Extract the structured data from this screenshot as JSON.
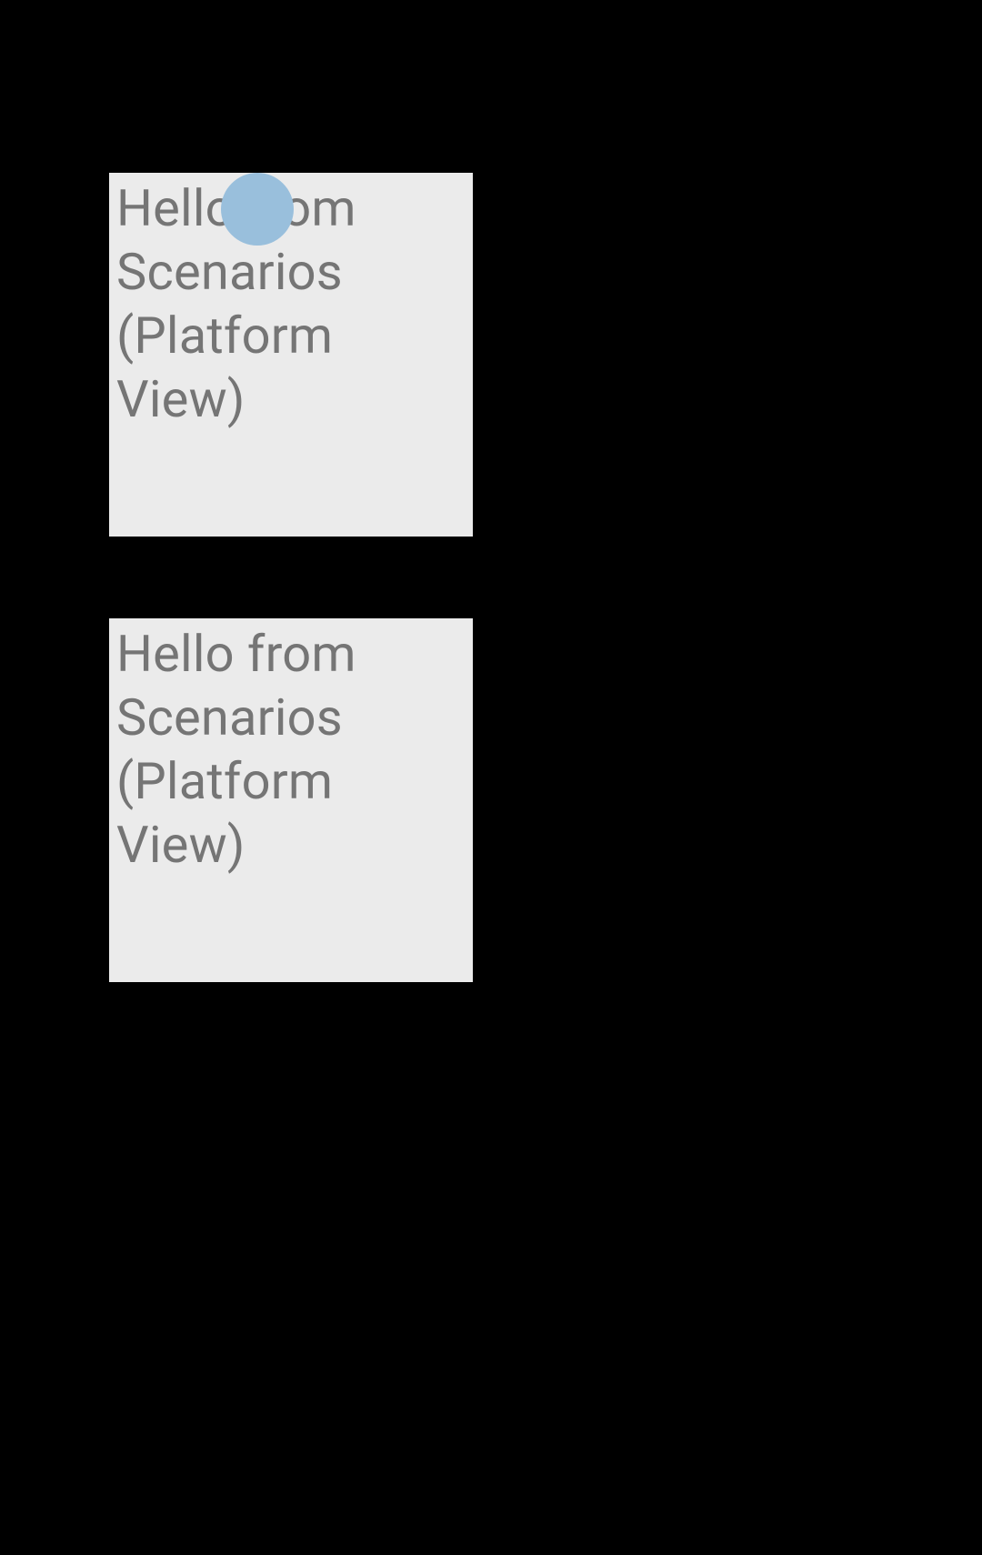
{
  "panels": [
    {
      "text": "Hello from Scenarios (Platform View)"
    },
    {
      "text": "Hello from Scenarios (Platform View)"
    }
  ],
  "touchIndicator": {
    "color": "#99BFDC"
  },
  "colors": {
    "panelBackground": "#EBEBEB",
    "textColor": "#757575",
    "pageBackground": "#000000"
  }
}
